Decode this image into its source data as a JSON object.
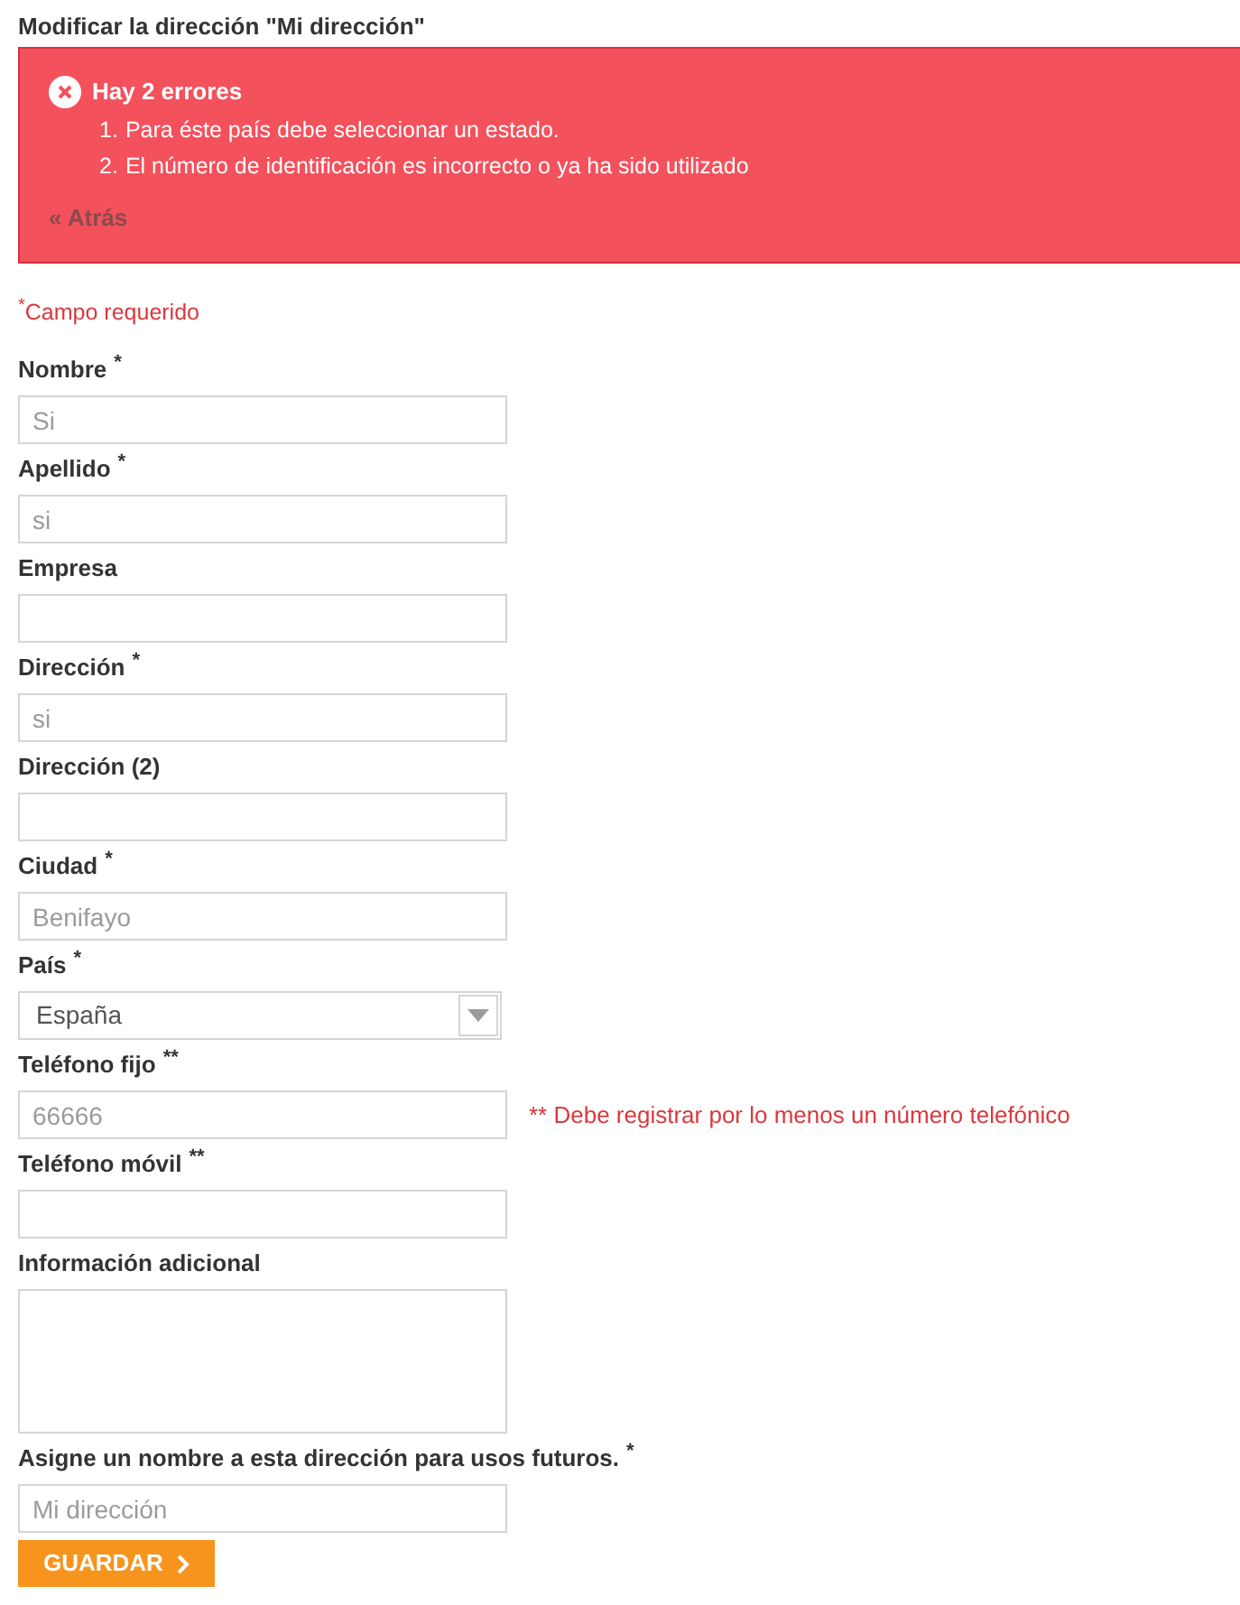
{
  "title": "Modificar la dirección \"Mi dirección\"",
  "error_box": {
    "heading": "Hay 2 errores",
    "errors": [
      {
        "number": "1.",
        "text": "Para éste país debe seleccionar un estado."
      },
      {
        "number": "2.",
        "text": "El número de identificación es incorrecto o ya ha sido utilizado"
      }
    ],
    "back_link": "« Atrás"
  },
  "required_note": {
    "mark": "*",
    "text": "Campo requerido"
  },
  "fields": [
    {
      "kind": "text",
      "label": "Nombre",
      "mark": "*",
      "value": "Si"
    },
    {
      "kind": "text",
      "label": "Apellido",
      "mark": "*",
      "value": "si"
    },
    {
      "kind": "text",
      "label": "Empresa"
    },
    {
      "kind": "text",
      "label": "Dirección",
      "mark": "*",
      "value": "si"
    },
    {
      "kind": "text",
      "label": "Dirección (2)"
    },
    {
      "kind": "text",
      "label": "Ciudad",
      "mark": "*",
      "value": "Benifayo"
    },
    {
      "kind": "select",
      "label": "País",
      "mark": "*",
      "value": "España"
    },
    {
      "kind": "text",
      "label": "Teléfono fijo",
      "mark": "**",
      "value": "66666",
      "note": "** Debe registrar por lo menos un número telefónico"
    },
    {
      "kind": "text",
      "label": "Teléfono móvil",
      "mark": "**"
    },
    {
      "kind": "textarea",
      "label": "Información adicional"
    },
    {
      "kind": "text",
      "label": "Asigne un nombre a esta dirección para usos futuros.",
      "mark": "*",
      "value": "Mi dirección"
    }
  ],
  "save_button": "GUARDAR"
}
